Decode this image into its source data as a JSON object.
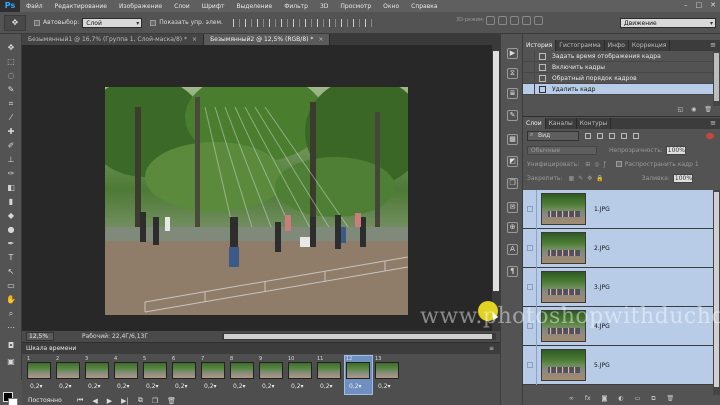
{
  "app": {
    "logo": "Ps"
  },
  "menu": [
    "Файл",
    "Редактирование",
    "Изображение",
    "Слои",
    "Шрифт",
    "Выделение",
    "Фильтр",
    "3D",
    "Просмотр",
    "Окно",
    "Справка"
  ],
  "options": {
    "autoselect_label": "Автовыбор:",
    "autoselect_value": "Слой",
    "show_controls_label": "Показать упр. элем.",
    "mode3d_label": "3D-режим:",
    "workspace": "Движение"
  },
  "documents": {
    "tabs": [
      {
        "label": "Безымянный1 @ 16,7% (Группа 1, Слой-маска/8) *"
      },
      {
        "label": "Безымянный2 @ 12,5% (RGB/8) *"
      }
    ]
  },
  "status": {
    "zoom": "12,5%",
    "doc_info": "Рабочий: 22,4Г/6,13Г"
  },
  "timeline": {
    "title": "Шкала времени",
    "frames": [
      {
        "num": "1",
        "delay": "0,2"
      },
      {
        "num": "2",
        "delay": "0,2"
      },
      {
        "num": "3",
        "delay": "0,2"
      },
      {
        "num": "4",
        "delay": "0,2"
      },
      {
        "num": "5",
        "delay": "0,2"
      },
      {
        "num": "6",
        "delay": "0,2"
      },
      {
        "num": "7",
        "delay": "0,2"
      },
      {
        "num": "8",
        "delay": "0,2"
      },
      {
        "num": "9",
        "delay": "0,2"
      },
      {
        "num": "10",
        "delay": "0,2"
      },
      {
        "num": "11",
        "delay": "0,2"
      },
      {
        "num": "12",
        "delay": "0,2"
      },
      {
        "num": "13",
        "delay": "0,2"
      }
    ],
    "selected_frame": "12",
    "loop": "Постоянно"
  },
  "history_panel": {
    "tabs": [
      "История",
      "Гистограмма",
      "Инфо",
      "Коррекция"
    ],
    "items": [
      {
        "label": "Задать время отображения кадра"
      },
      {
        "label": "Включить кадры"
      },
      {
        "label": "Обратный порядок кадров"
      },
      {
        "label": "Удалить кадр"
      }
    ]
  },
  "layers_panel": {
    "tabs": [
      "Слои",
      "Каналы",
      "Контуры"
    ],
    "kind": "Вид",
    "blend_mode": "Обычные",
    "opacity_label": "Непрозрачность:",
    "opacity_value": "100%",
    "unify_label": "Унифицировать:",
    "propagate_label": "Распространить кадр 1",
    "lock_label": "Закрепить:",
    "fill_label": "Заливка:",
    "fill_value": "100%",
    "layers": [
      {
        "name": "1.JPG"
      },
      {
        "name": "2.JPG"
      },
      {
        "name": "3.JPG"
      },
      {
        "name": "4.JPG"
      },
      {
        "name": "5.JPG"
      }
    ]
  },
  "watermark": "www.photoshopwithduchok.ru",
  "colors": {
    "selection": "#b8cce8",
    "accent": "#31a8ff"
  }
}
